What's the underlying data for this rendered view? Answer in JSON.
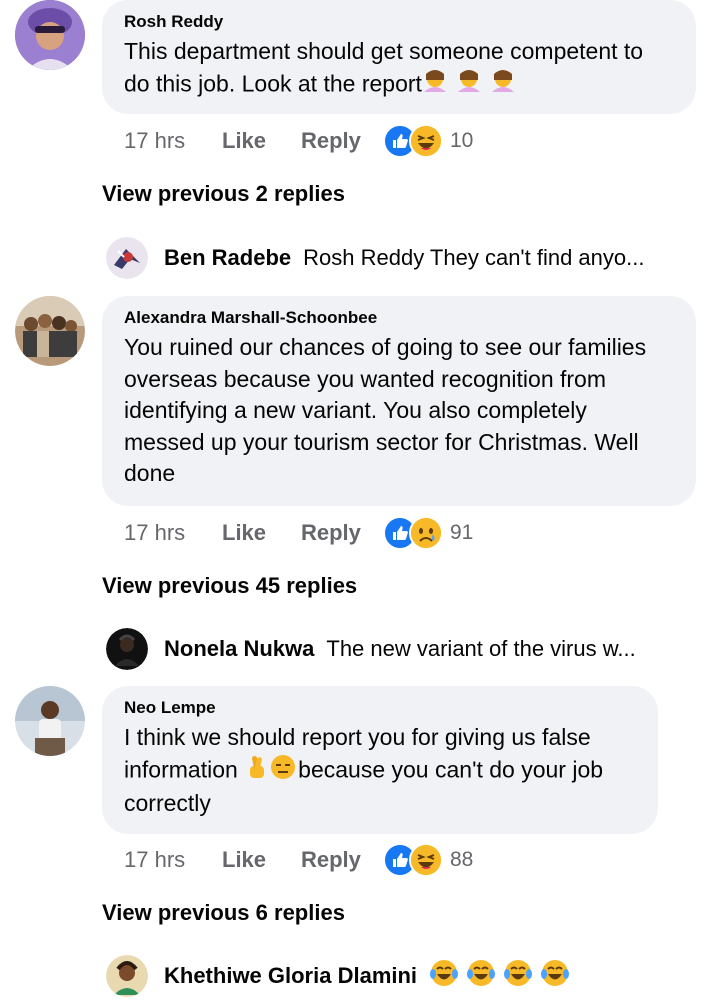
{
  "comments": [
    {
      "author": "Rosh Reddy",
      "text_lines": [
        "This department should get someone competent to",
        "do this job. Look at the report"
      ],
      "time": "17 hrs",
      "like": "Like",
      "reply": "Reply",
      "reaction_icons": [
        "like-icon",
        "laugh-icon"
      ],
      "reaction_count": "10"
    },
    {
      "author": "Alexandra Marshall-Schoonbee",
      "text_lines": [
        "You ruined our chances of going to see our families",
        "overseas because you wanted recognition from",
        "identifying a new variant. You also completely",
        "messed up your tourism sector for Christmas. Well",
        "done"
      ],
      "time": "17 hrs",
      "like": "Like",
      "reply": "Reply",
      "reaction_icons": [
        "like-icon",
        "sad-icon"
      ],
      "reaction_count": "91"
    },
    {
      "author": "Neo Lempe",
      "text_lines": [
        "I think we should report you for giving us false",
        "information",
        "because you can't do your job",
        "correctly"
      ],
      "time": "17 hrs",
      "like": "Like",
      "reply": "Reply",
      "reaction_icons": [
        "like-icon",
        "laugh-icon"
      ],
      "reaction_count": "88"
    }
  ],
  "view_previous": [
    "View previous 2 replies",
    "View previous 45 replies",
    "View previous 6 replies"
  ],
  "replies": [
    {
      "author": "Ben Radebe",
      "snippet": "Rosh Reddy They can't find anyo..."
    },
    {
      "author": "Nonela Nukwa",
      "snippet": "The new variant of the virus w..."
    },
    {
      "author": "Khethiwe Gloria Dlamini",
      "snippet": ""
    }
  ],
  "colors": {
    "bubble": "#f0f2f5",
    "like_blue": "#1877f2",
    "emoji_yellow": "#f7b928",
    "meta_grey": "#65676b"
  }
}
